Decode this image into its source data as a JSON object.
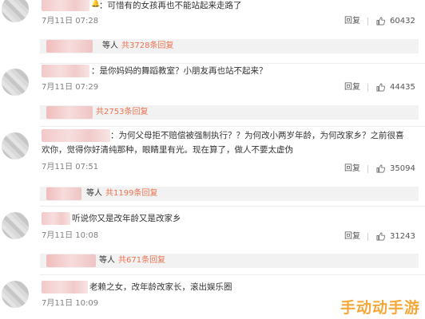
{
  "comments": [
    {
      "text": "：可惜有的女孩再也不能站起来走路了",
      "date": "7月11日 07:28",
      "reply_label": "回复",
      "likes": "60432",
      "replies_prefix": "等人",
      "replies_link": "共3728条回复"
    },
    {
      "text": "：是你妈妈的舞蹈教室？小朋友再也站不起来？",
      "date": "7月11日 07:29",
      "reply_label": "回复",
      "likes": "44435",
      "replies_prefix": "",
      "replies_link": "共2753条回复"
    },
    {
      "text_line1": "：为何父母拒不赔偿被强制执行？？为何改小两岁年龄，为何改家乡？之前很喜",
      "text_line2": "欢你，觉得你好清纯那种，眼睛里有光。现在算了，做人不要太虚伪",
      "date": "7月11日 07:51",
      "reply_label": "回复",
      "likes": "35094",
      "replies_prefix": "等人",
      "replies_link": "共1199条回复"
    },
    {
      "text": "听说你又是改年龄又是改家乡",
      "date": "7月11日 10:08",
      "reply_label": "回复",
      "likes": "31243",
      "replies_prefix": "等人",
      "replies_link": "共671条回复"
    },
    {
      "text": "老赖之女，改年龄改家长，滚出娱乐圈",
      "date": "7月11日 10:09"
    }
  ],
  "watermark": "手动动手游",
  "colors": {
    "link": "#eb7350",
    "gray_text": "#808080",
    "reply_bg": "#f2f2f2",
    "watermark": "#f5a83a"
  },
  "icons": [
    "thumbs-up-icon",
    "notification-icon"
  ]
}
